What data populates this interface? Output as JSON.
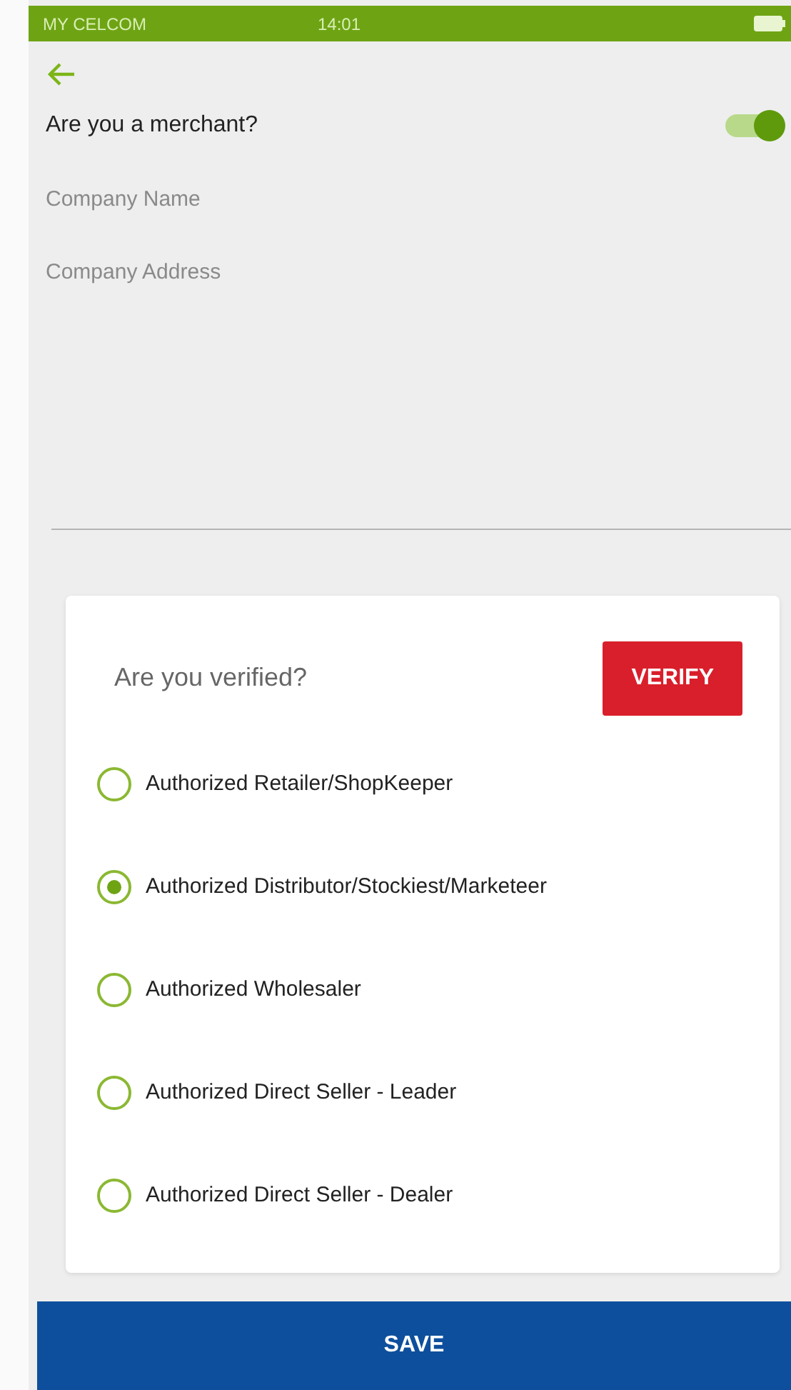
{
  "status_bar": {
    "carrier": "MY CELCOM",
    "time": "14:01"
  },
  "merchant": {
    "label": "Are you a merchant?",
    "on": true
  },
  "fields": [
    {
      "placeholder": "Company Name"
    },
    {
      "placeholder": "Company Address"
    }
  ],
  "verification": {
    "question": "Are you verified?",
    "button": "VERIFY",
    "options": [
      {
        "label": "Authorized Retailer/ShopKeeper",
        "selected": false
      },
      {
        "label": "Authorized Distributor/Stockiest/Marketeer",
        "selected": true
      },
      {
        "label": "Authorized Wholesaler",
        "selected": false
      },
      {
        "label": "Authorized Direct Seller - Leader",
        "selected": false
      },
      {
        "label": "Authorized Direct Seller - Dealer",
        "selected": false
      }
    ]
  },
  "save_button": "SAVE"
}
